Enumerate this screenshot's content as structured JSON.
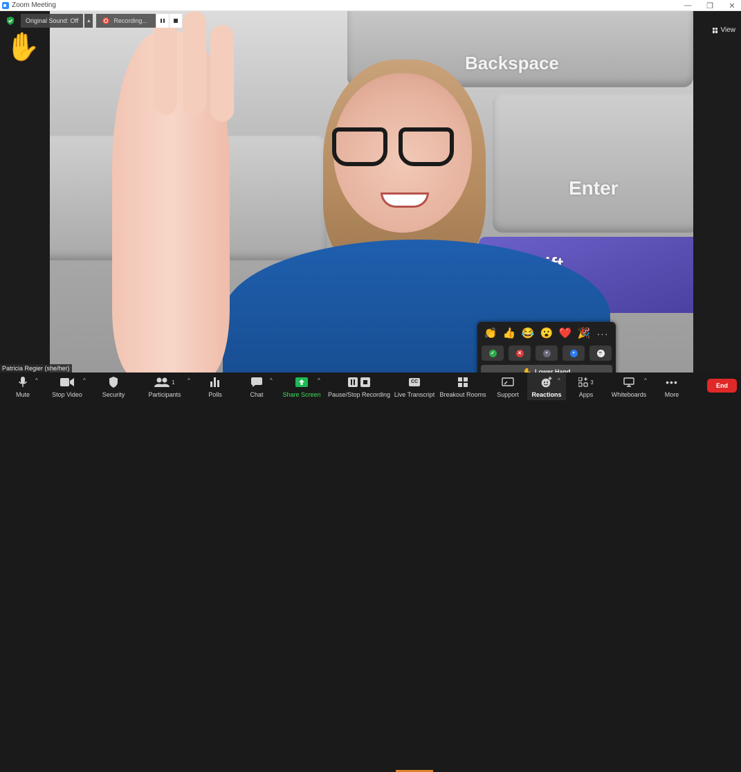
{
  "window": {
    "title": "Zoom Meeting"
  },
  "meeting": {
    "original_sound": "Original Sound: Off",
    "recording_label": "Recording...",
    "view_label": "View",
    "participant_name": "Patricia Regier (she/her)",
    "raised_hand_emoji": "✋"
  },
  "reactions": {
    "emojis": [
      "👏",
      "👍",
      "😂",
      "😮",
      "❤️",
      "🎉"
    ],
    "more": "···",
    "lower_hand": "Lower Hand"
  },
  "toolbar": {
    "mute": "Mute",
    "stop_video": "Stop Video",
    "security": "Security",
    "participants": "Participants",
    "participants_count": "1",
    "polls": "Polls",
    "chat": "Chat",
    "share_screen": "Share Screen",
    "pause_stop_recording": "Pause/Stop Recording",
    "live_transcript": "Live Transcript",
    "cc": "CC",
    "breakout_rooms": "Breakout Rooms",
    "support": "Support",
    "reactions": "Reactions",
    "apps": "Apps",
    "apps_count": "3",
    "whiteboards": "Whiteboards",
    "more": "More",
    "end": "End"
  },
  "background_keys": {
    "backspace": "Backspace",
    "enter": "Enter",
    "shift": "Shift"
  },
  "colors": {
    "end": "#e02828",
    "share_green": "#1db954",
    "share_label": "#3ddc5b",
    "security_green": "#22a846"
  }
}
